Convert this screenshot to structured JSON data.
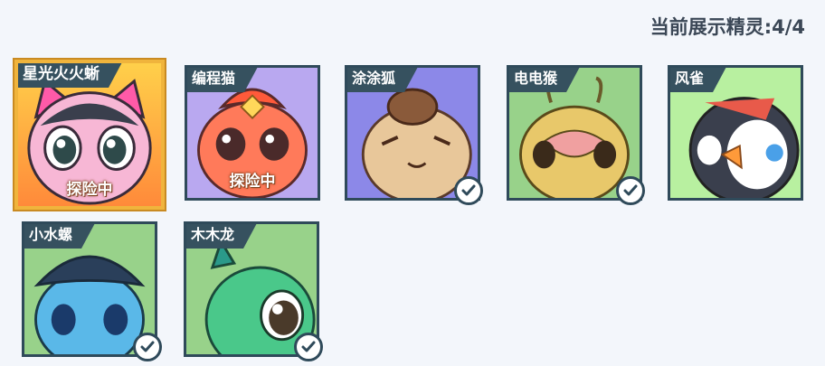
{
  "header": {
    "display_count": "当前展示精灵:4/4"
  },
  "creatures": [
    {
      "name": "星光火火蜥",
      "status": "探险中",
      "active": true,
      "selected": false
    },
    {
      "name": "编程猫",
      "status": "探险中",
      "active": false,
      "selected": false
    },
    {
      "name": "涂涂狐",
      "status": "",
      "active": false,
      "selected": true
    },
    {
      "name": "电电猴",
      "status": "",
      "active": false,
      "selected": true
    },
    {
      "name": "风雀",
      "status": "",
      "active": false,
      "selected": false
    },
    {
      "name": "小水螺",
      "status": "",
      "active": false,
      "selected": true
    },
    {
      "name": "木木龙",
      "status": "",
      "active": false,
      "selected": true
    }
  ],
  "colors": {
    "tag_bg": "#36515f",
    "border": "#2f4a5a",
    "active_border": "#f0b43c"
  },
  "icons": {
    "selected_check": "checkmark-circle-icon"
  }
}
